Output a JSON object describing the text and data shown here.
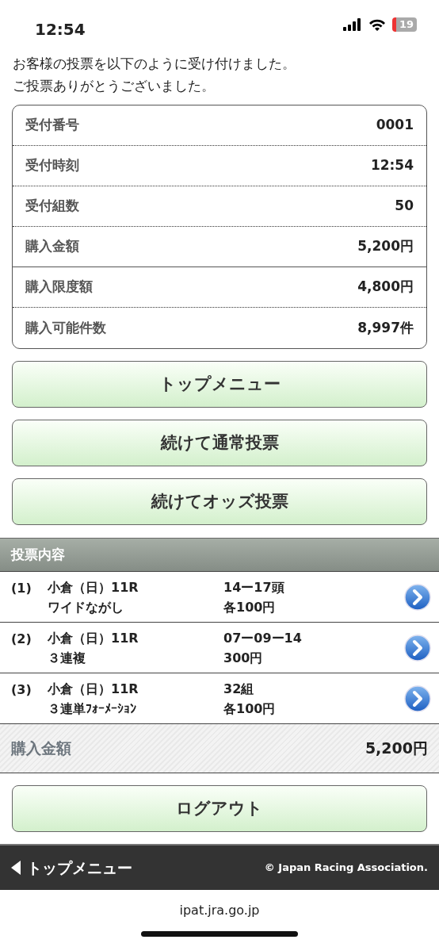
{
  "status_bar": {
    "time": "12:54",
    "battery": "19"
  },
  "message": [
    "お客様の投票を以下のように受け付けました。",
    "ご投票ありがとうございました。"
  ],
  "receipt": [
    {
      "label": "受付番号",
      "value": "0001"
    },
    {
      "label": "受付時刻",
      "value": "12:54"
    },
    {
      "label": "受付組数",
      "value": "50"
    },
    {
      "label": "購入金額",
      "value": "5,200円"
    }
  ],
  "limits": [
    {
      "label": "購入限度額",
      "value": "4,800円"
    },
    {
      "label": "購入可能件数",
      "value": "8,997件"
    }
  ],
  "buttons": [
    "トップメニュー",
    "続けて通常投票",
    "続けてオッズ投票"
  ],
  "bets_section": {
    "title": "投票内容",
    "bets": [
      {
        "number": "(1)",
        "race": "小倉（日）11R",
        "type": "ワイドながし",
        "combination": "14ー17頭",
        "amount": "各100円"
      },
      {
        "number": "(2)",
        "race": "小倉（日）11R",
        "type": "３連複",
        "combination": "07ー09ー14",
        "amount": "300円"
      },
      {
        "number": "(3)",
        "race": "小倉（日）11R",
        "type": "３連単ﾌｫｰﾒｰｼｮﾝ",
        "combination": "32組",
        "amount": "各100円"
      }
    ],
    "total": {
      "label": "購入金額",
      "value": "5,200円"
    }
  },
  "logout_button": "ログアウト",
  "footer": {
    "back_link": "トップメニュー",
    "copyright": "© Japan Racing Association."
  },
  "url": "ipat.jra.go.jp"
}
